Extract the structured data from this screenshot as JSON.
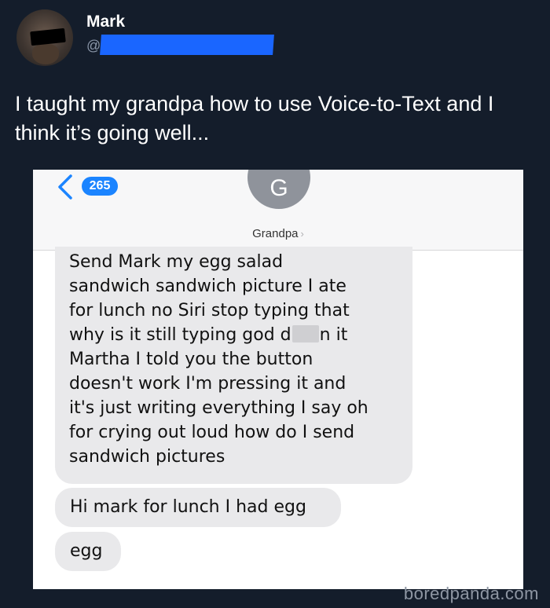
{
  "tweet": {
    "display_name": "Mark",
    "handle_prefix": "@",
    "text": "I taught my grandpa how to use Voice-to-Text and I think it’s going well..."
  },
  "screenshot": {
    "unread_count": "265",
    "contact_initial": "G",
    "contact_name": "Grandpa",
    "contact_chevron": "›",
    "messages": [
      {
        "lines": [
          "Send Mark my egg salad",
          "sandwich sandwich picture I ate",
          "for lunch no Siri stop typing that",
          [
            "why is it still typing god d",
            "n it"
          ],
          "Martha I told you the button",
          "doesn't work I'm pressing it and",
          "it's just writing everything I say oh",
          "for crying out loud how do I send",
          "sandwich pictures"
        ]
      },
      {
        "text": "Hi mark for lunch I had egg"
      },
      {
        "text": "egg"
      }
    ]
  },
  "watermark": "boredpanda.com",
  "colors": {
    "background": "#141d2b",
    "badge": "#1b84ff",
    "bubble": "#e9e9eb",
    "redaction": "#1a66ff"
  },
  "icons": [
    "back-chevron-icon",
    "contact-chevron-icon"
  ]
}
